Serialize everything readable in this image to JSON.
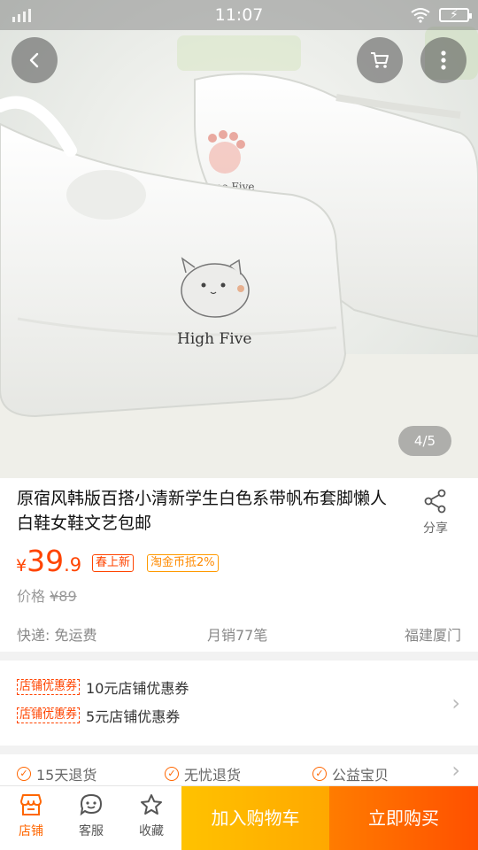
{
  "status_bar": {
    "time": "11:07"
  },
  "hero": {
    "page_indicator": "4/5",
    "shoe_text": "High Five",
    "shoe_text_back": "Give me Five",
    "buttons": {
      "back": "back-icon",
      "cart": "cart-icon",
      "more": "more-icon"
    }
  },
  "product": {
    "title": "原宿风韩版百搭小清新学生白色系带帆布套脚懒人白鞋女鞋文艺包邮",
    "share_label": "分享",
    "price": {
      "currency": "¥",
      "integer": "39",
      "decimal": ".9"
    },
    "tags": [
      "春上新",
      "淘金币抵2%"
    ],
    "original_price": {
      "label": "价格",
      "value": "¥89"
    },
    "shipping": "快递: 免运费",
    "monthly_sales": "月销77笔",
    "location": "福建厦门"
  },
  "coupons": [
    {
      "tag": "店铺优惠券",
      "text": "10元店铺优惠券"
    },
    {
      "tag": "店铺优惠券",
      "text": "5元店铺优惠券"
    }
  ],
  "services": [
    "15天退货",
    "无忧退货",
    "公益宝贝"
  ],
  "bottom_bar": {
    "store": "店铺",
    "customer_service": "客服",
    "favorite": "收藏",
    "add_to_cart": "加入购物车",
    "buy_now": "立即购买"
  },
  "colors": {
    "accent": "#ff4400",
    "cart_button": "#ffb400",
    "buy_button": "#ff6a00"
  }
}
